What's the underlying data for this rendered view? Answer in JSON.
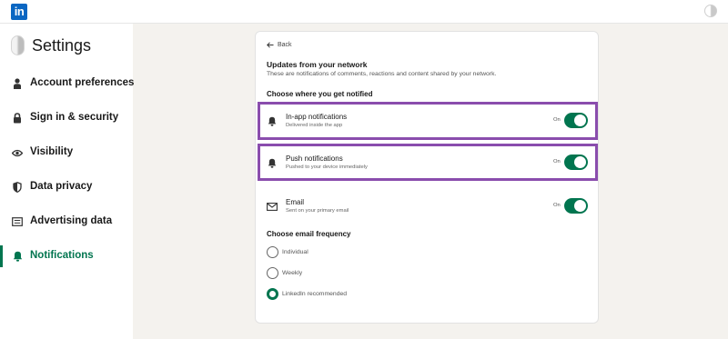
{
  "header": {
    "logo_text": "in",
    "brand_color": "#0a66c2"
  },
  "sidebar": {
    "title": "Settings",
    "active_color": "#01754f",
    "items": [
      {
        "label": "Account preferences",
        "icon": "person-icon",
        "active": false
      },
      {
        "label": "Sign in & security",
        "icon": "lock-icon",
        "active": false
      },
      {
        "label": "Visibility",
        "icon": "eye-icon",
        "active": false
      },
      {
        "label": "Data privacy",
        "icon": "shield-icon",
        "active": false
      },
      {
        "label": "Advertising data",
        "icon": "newspaper-icon",
        "active": false
      },
      {
        "label": "Notifications",
        "icon": "bell-icon",
        "active": true
      }
    ]
  },
  "main": {
    "back_label": "Back",
    "title": "Updates from your network",
    "description": "These are notifications of comments, reactions and content shared by your network.",
    "channels_heading": "Choose where you get notified",
    "channels": [
      {
        "label": "In-app notifications",
        "sub": "Delivered inside the app",
        "state": "On",
        "on": true,
        "icon": "bell-icon",
        "highlighted": true
      },
      {
        "label": "Push notifications",
        "sub": "Pushed to your device immediately",
        "state": "On",
        "on": true,
        "icon": "bell-icon",
        "highlighted": true
      },
      {
        "label": "Email",
        "sub": "Sent on your primary email",
        "state": "On",
        "on": true,
        "icon": "envelope-icon",
        "highlighted": false
      }
    ],
    "frequency_heading": "Choose email frequency",
    "frequency_options": [
      {
        "label": "Individual",
        "selected": false
      },
      {
        "label": "Weekly",
        "selected": false
      },
      {
        "label": "LinkedIn recommended",
        "selected": true
      }
    ],
    "highlight_color": "#8a4dad",
    "toggle_color": "#01754f"
  }
}
